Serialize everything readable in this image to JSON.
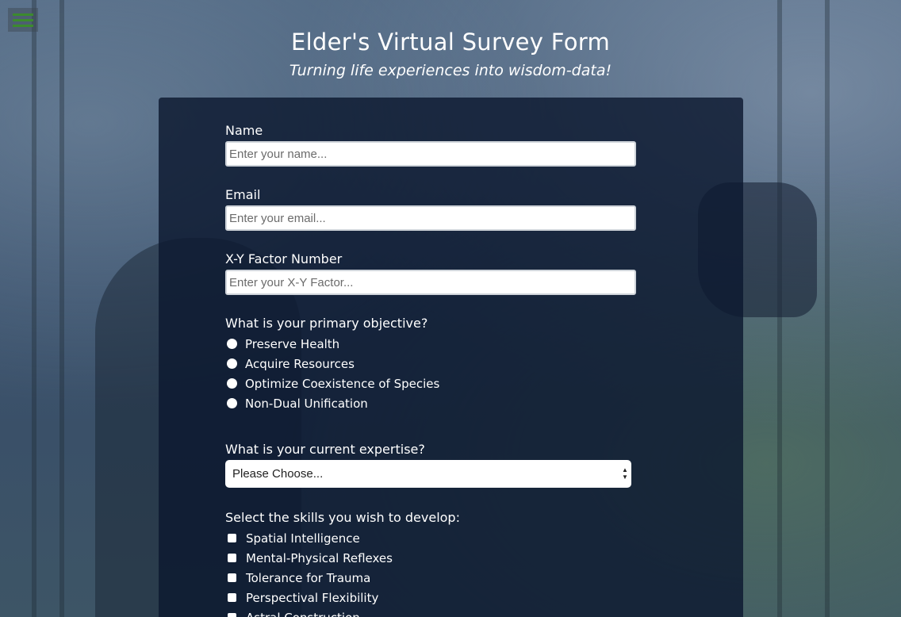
{
  "header": {
    "title": "Elder's Virtual Survey Form",
    "subtitle": "Turning life experiences into wisdom-data!"
  },
  "menu": {
    "icon": "hamburger-menu-icon",
    "color": "#3c8a2e"
  },
  "form": {
    "name": {
      "label": "Name",
      "placeholder": "Enter your name..."
    },
    "email": {
      "label": "Email",
      "placeholder": "Enter your email..."
    },
    "xy_factor": {
      "label": "X-Y Factor Number",
      "placeholder": "Enter your X-Y Factor..."
    },
    "objective": {
      "label": "What is your primary objective?",
      "options": [
        "Preserve Health",
        "Acquire Resources",
        "Optimize Coexistence of Species",
        "Non-Dual Unification"
      ]
    },
    "expertise": {
      "label": "What is your current expertise?",
      "selected": "Please Choose..."
    },
    "skills": {
      "label": "Select the skills you wish to develop:",
      "options": [
        "Spatial Intelligence",
        "Mental-Physical Reflexes",
        "Tolerance for Trauma",
        "Perspectival Flexibility",
        "Astral Construction"
      ]
    }
  },
  "colors": {
    "panel": "#0c1930",
    "text": "#ffffff",
    "menu_accent": "#3c8a2e"
  }
}
